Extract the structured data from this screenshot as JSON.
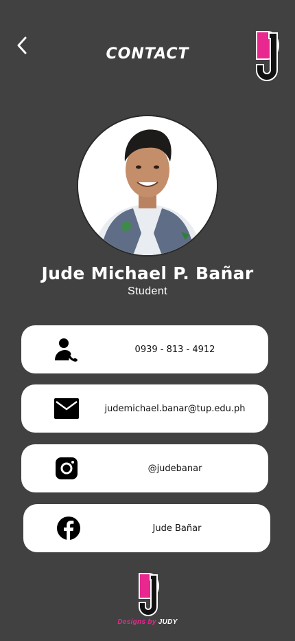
{
  "header": {
    "title": "CONTACT",
    "back_icon": "chevron-left-icon",
    "logo_label": "JUDY"
  },
  "profile": {
    "name": "Jude Michael P. Bañar",
    "role": "Student"
  },
  "contacts": [
    {
      "icon": "phone-person-icon",
      "value": "0939 - 813 - 4912"
    },
    {
      "icon": "mail-icon",
      "value": "judemichael.banar@tup.edu.ph"
    },
    {
      "icon": "instagram-icon",
      "value": "@judebanar"
    },
    {
      "icon": "facebook-icon",
      "value": "Jude Bañar"
    }
  ],
  "footer": {
    "credit_prefix": "Designs by",
    "credit_name": "JUDY",
    "logo_label": "JUDY"
  },
  "colors": {
    "background": "#414141",
    "card": "#ffffff",
    "accent": "#e8278f",
    "text": "#ffffff"
  }
}
